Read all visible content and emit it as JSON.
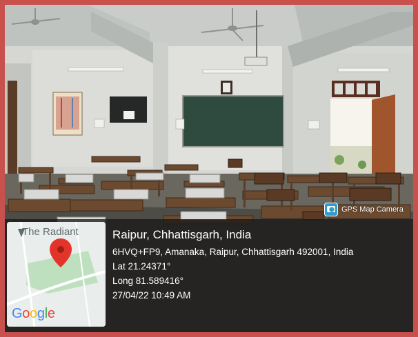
{
  "camera_badge": {
    "label": "GPS Map Camera",
    "icon": "gps-map-camera-icon",
    "color": "#2e9ad6"
  },
  "map": {
    "place_label": "The Radiant",
    "brand": "Google",
    "pin_color": "#e2342a"
  },
  "location": {
    "city": "Raipur, Chhattisgarh, India",
    "address": "6HVQ+FP9, Amanaka, Raipur, Chhattisgarh 492001, India",
    "lat": "Lat 21.24371°",
    "long": "Long 81.589416°",
    "timestamp": "27/04/22 10:49 AM"
  },
  "frame_color": "#c8504d"
}
